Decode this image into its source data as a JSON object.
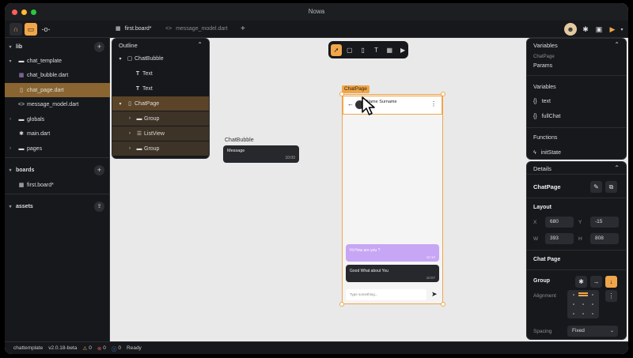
{
  "app": {
    "title": "Nowa"
  },
  "tabs": [
    {
      "label": "first.board*",
      "icon": "board-icon"
    },
    {
      "label": "message_model.dart",
      "icon": "code-icon"
    }
  ],
  "sidebar": {
    "lib_label": "lib",
    "files": [
      {
        "label": "chat_template",
        "icon": "folder-icon"
      },
      {
        "label": "chat_bubble.dart",
        "icon": "widget-icon"
      },
      {
        "label": "chat_page.dart",
        "icon": "phone-icon",
        "selected": true
      },
      {
        "label": "message_model.dart",
        "icon": "code-icon"
      },
      {
        "label": "globals",
        "icon": "folder-icon"
      },
      {
        "label": "main.dart",
        "icon": "gear-icon"
      },
      {
        "label": "pages",
        "icon": "folder-icon"
      }
    ],
    "boards_label": "boards",
    "boards": [
      {
        "label": "first.board*",
        "icon": "board-icon"
      }
    ],
    "assets_label": "assets"
  },
  "outline": {
    "title": "Outline",
    "items": [
      {
        "label": "ChatBubble",
        "icon": "square-icon"
      },
      {
        "label": "Text",
        "icon": "text-icon"
      },
      {
        "label": "Text",
        "icon": "text-icon"
      },
      {
        "label": "ChatPage",
        "icon": "phone-icon"
      },
      {
        "label": "Group",
        "icon": "folder-icon"
      },
      {
        "label": "ListView",
        "icon": "list-icon"
      },
      {
        "label": "Group",
        "icon": "folder-icon"
      }
    ]
  },
  "canvas": {
    "chatbubble_label": "ChatBubble",
    "chatbubble_message": "Message",
    "chatbubble_time": "10:00",
    "chatpage_tag": "ChatPage",
    "contact_name": "Name Surname",
    "bubble1_text": "Hi How are you ?",
    "bubble1_time": "10:10",
    "bubble2_text": "Good What about You",
    "bubble2_time": "10:07",
    "input_placeholder": "Type something..."
  },
  "variables": {
    "title": "Variables",
    "section_label": "ChatPage",
    "params_label": "Params",
    "variables_label": "Variables",
    "vars": [
      {
        "label": "text"
      },
      {
        "label": "fullChat"
      }
    ],
    "functions_label": "Functions",
    "functions": [
      {
        "label": "initState"
      }
    ]
  },
  "details": {
    "title": "Details",
    "widget_name": "ChatPage",
    "layout_label": "Layout",
    "x_label": "X",
    "x_value": "680",
    "y_label": "Y",
    "y_value": "-15",
    "w_label": "W",
    "w_value": "393",
    "h_label": "H",
    "h_value": "808",
    "section2_label": "Chat Page",
    "group_label": "Group",
    "alignment_label": "Alignment",
    "spacing_label": "Spacing",
    "spacing_value": "Fixed"
  },
  "status": {
    "project": "chattemplate",
    "version": "v2.0.18-beta",
    "warnings": "0",
    "errors": "0",
    "info": "0",
    "state": "Ready"
  },
  "colors": {
    "accent": "#f0a64a",
    "panel": "#16181c",
    "canvas": "#e9e9e9",
    "bubble_purple": "#c7a6f5"
  }
}
